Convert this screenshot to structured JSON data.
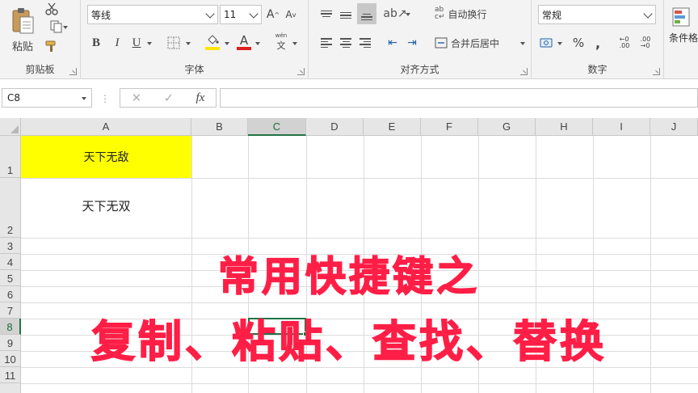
{
  "ribbon": {
    "clipboard": {
      "paste_label": "粘贴",
      "group_label": "剪贴板"
    },
    "font": {
      "font_name": "等线",
      "font_size": "11",
      "bold": "B",
      "italic": "I",
      "underline": "U",
      "grow": "A",
      "shrink": "A",
      "font_color_glyph": "A",
      "wen_glyph": "文",
      "group_label": "字体"
    },
    "alignment": {
      "wrap_label": "自动换行",
      "merge_label": "合并后居中",
      "group_label": "对齐方式"
    },
    "number": {
      "format": "常规",
      "percent": "%",
      "comma": ",",
      "group_label": "数字"
    },
    "styles": {
      "conditional_label": "条件格"
    },
    "accent_fill": "#ffe600",
    "accent_font": "#e02020"
  },
  "formula_bar": {
    "name_box": "C8",
    "dots": "⋮",
    "cancel": "✕",
    "enter": "✓",
    "fx": "fx",
    "value": ""
  },
  "sheet": {
    "columns": [
      "A",
      "B",
      "C",
      "D",
      "E",
      "F",
      "G",
      "H",
      "I",
      "J"
    ],
    "rows": [
      "1",
      "2",
      "3",
      "4",
      "5",
      "6",
      "7",
      "8",
      "9",
      "10",
      "11"
    ],
    "active_cell": "C8",
    "cells": {
      "A1": "天下无敌",
      "A2": "天下无双"
    },
    "a1_fill": "#ffff00"
  },
  "caption": {
    "line1": "常用快捷键之",
    "line2": "复制、粘贴、查找、替换",
    "color": "#ff1e46"
  }
}
